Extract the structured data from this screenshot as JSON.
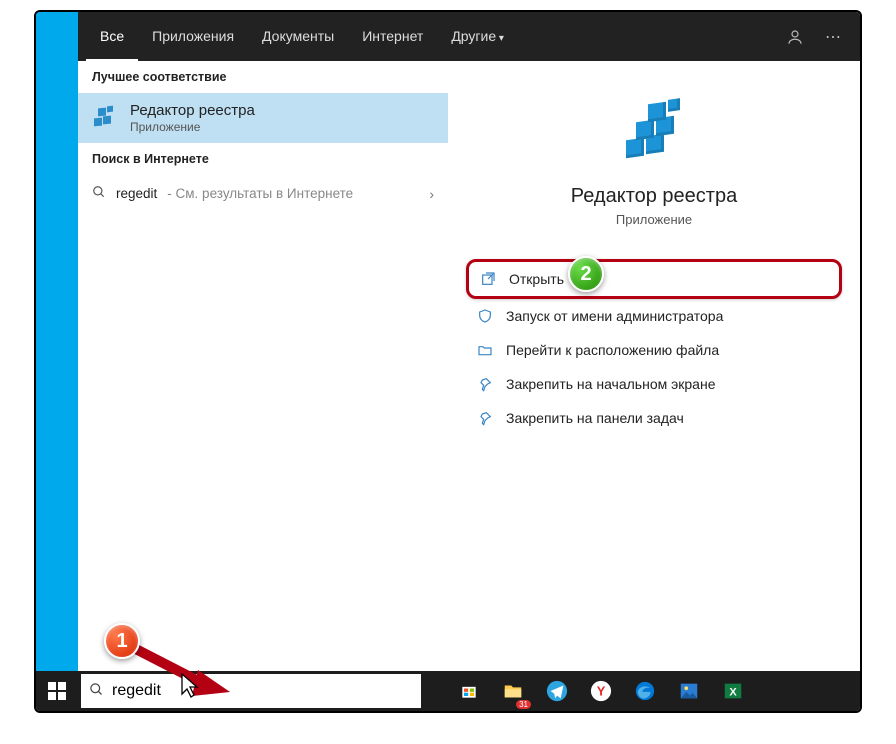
{
  "header": {
    "tabs": [
      "Все",
      "Приложения",
      "Документы",
      "Интернет",
      "Другие"
    ]
  },
  "leftcol": {
    "best_match_header": "Лучшее соответствие",
    "best_match": {
      "title": "Редактор реестра",
      "subtitle": "Приложение"
    },
    "internet_header": "Поиск в Интернете",
    "web": {
      "term": "regedit",
      "suffix": " - См. результаты в Интернете"
    }
  },
  "rightcol": {
    "title": "Редактор реестра",
    "subtitle": "Приложение",
    "actions": [
      {
        "label": "Открыть",
        "icon": "open"
      },
      {
        "label": "Запуск от имени администратора",
        "icon": "admin"
      },
      {
        "label": "Перейти к расположению файла",
        "icon": "folder"
      },
      {
        "label": "Закрепить на начальном экране",
        "icon": "pin"
      },
      {
        "label": "Закрепить на панели задач",
        "icon": "pin"
      }
    ]
  },
  "search": {
    "value": "regedit"
  },
  "badges": {
    "one": "1",
    "two": "2"
  }
}
